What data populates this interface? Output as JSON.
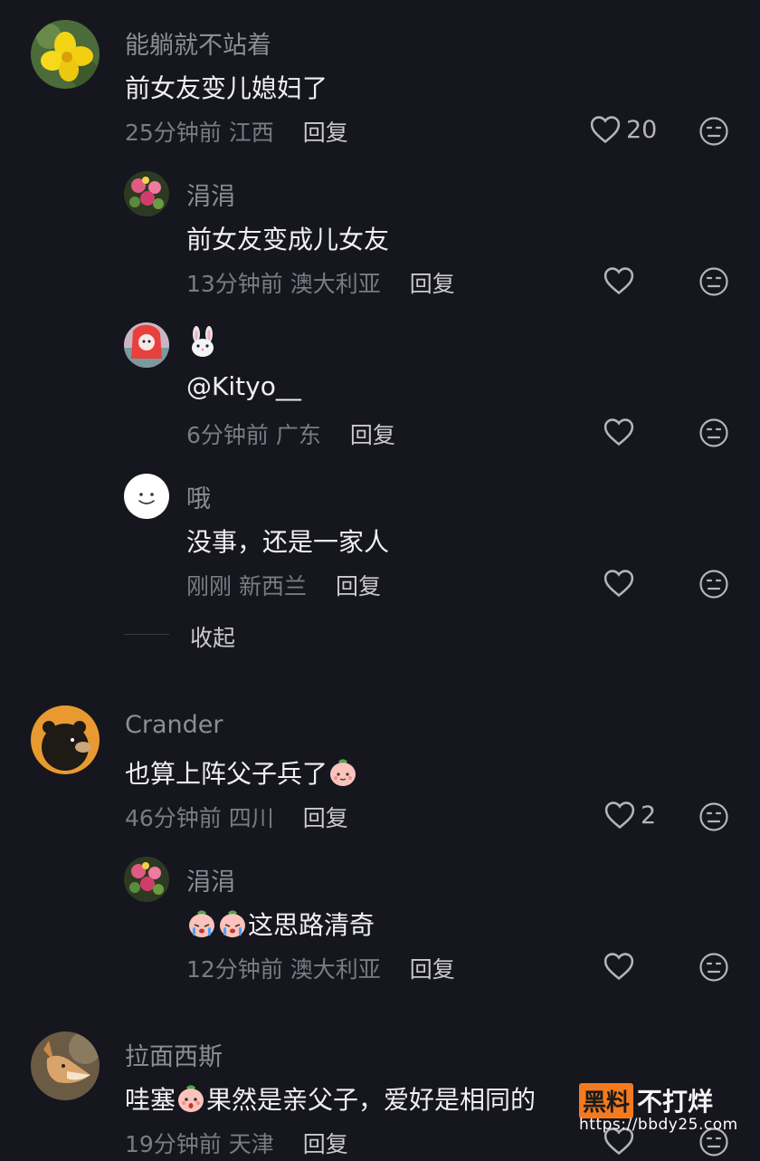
{
  "comments": [
    {
      "name": "能躺就不站着",
      "text": "前女友变儿媳妇了",
      "time": "25分钟前",
      "location": "江西",
      "reply_label": "回复",
      "likes": "20",
      "replies": [
        {
          "name": "涓涓",
          "text": "前女友变成儿女友",
          "time": "13分钟前",
          "location": "澳大利亚",
          "reply_label": "回复"
        },
        {
          "name": "🐰",
          "text": "@Kityo__",
          "time": "6分钟前",
          "location": "广东",
          "reply_label": "回复"
        },
        {
          "name": "哦",
          "text": "没事，还是一家人",
          "time": "刚刚",
          "location": "新西兰",
          "reply_label": "回复"
        }
      ],
      "collapse_label": "收起"
    },
    {
      "name": "Crander",
      "text": "也算上阵父子兵了",
      "time": "46分钟前",
      "location": "四川",
      "reply_label": "回复",
      "likes": "2",
      "replies": [
        {
          "name": "涓涓",
          "text": "这思路清奇",
          "time": "12分钟前",
          "location": "澳大利亚",
          "reply_label": "回复"
        }
      ]
    },
    {
      "name": "拉面西斯",
      "text_pre": "哇塞",
      "text_post": "果然是亲父子，爱好是相同的",
      "time": "19分钟前",
      "location": "天津",
      "reply_label": "回复"
    }
  ],
  "watermark": {
    "box": "黑料",
    "text": "不打烊",
    "url": "https://bbdy25.com"
  },
  "colors": {
    "background": "#16161e",
    "name": "#8d8d96",
    "meta": "#7b7b84",
    "watermark": "#f47a1f"
  }
}
